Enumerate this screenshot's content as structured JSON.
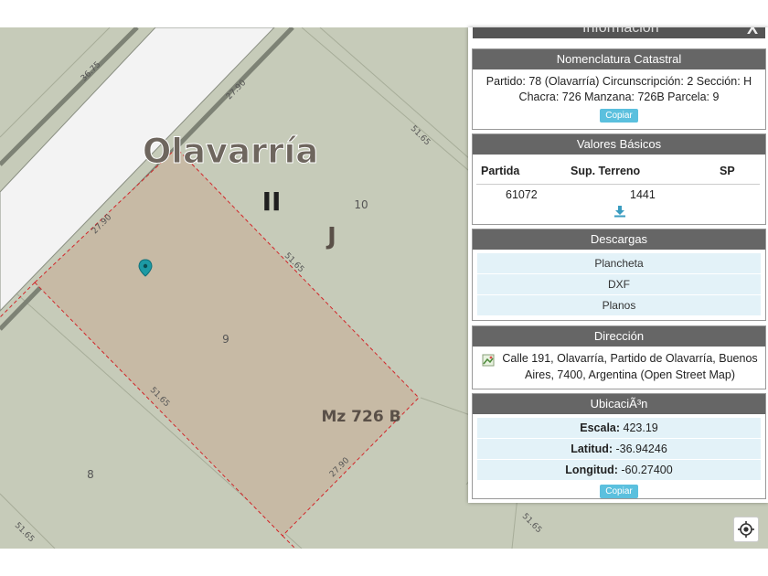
{
  "panel": {
    "top_title": "Información",
    "close_label": "X"
  },
  "nomenclatura": {
    "header": "Nomenclatura Catastral",
    "line1": "Partido: 78 (Olavarría) Circunscripción: 2 Sección: H",
    "line2": "Chacra: 726 Manzana: 726B Parcela: 9",
    "copy_label": "Copiar"
  },
  "valores": {
    "header": "Valores Básicos",
    "columns": [
      "Partida",
      "Sup. Terreno",
      "SP"
    ],
    "row": [
      "61072",
      "1441",
      ""
    ]
  },
  "descargas": {
    "header": "Descargas",
    "items": [
      "Plancheta",
      "DXF",
      "Planos"
    ]
  },
  "direccion": {
    "header": "Dirección",
    "line1": "Calle 191, Olavarría, Partido de Olavarría, Buenos",
    "line2": "Aires, 7400, Argentina (Open Street Map)"
  },
  "ubicacion": {
    "header": "UbicaciÃ³n",
    "escala_label": "Escala:",
    "escala_value": " 423.19",
    "latitud_label": "Latitud:",
    "latitud_value": " -36.94246",
    "longitud_label": "Longitud:",
    "longitud_value": " -60.27400",
    "copy_label": "Copiar"
  },
  "map": {
    "city_label": "Olavarría",
    "roman_label": "II",
    "letter_label": "J",
    "manzana_label": "Mz 726 B",
    "lot_9": "9",
    "lot_10": "10",
    "lot_8": "8",
    "dim_3675": "36.75",
    "dim_2790_top": "27.90",
    "dim_5165_right": "51.65",
    "dim_2790_left": "27.90",
    "dim_5165_mid": "51.65",
    "dim_5165_bottom": "51.65",
    "dim_2790_bottom": "27.90",
    "dim_5165_bl": "51.65",
    "dim_5165_br": "51.65"
  }
}
